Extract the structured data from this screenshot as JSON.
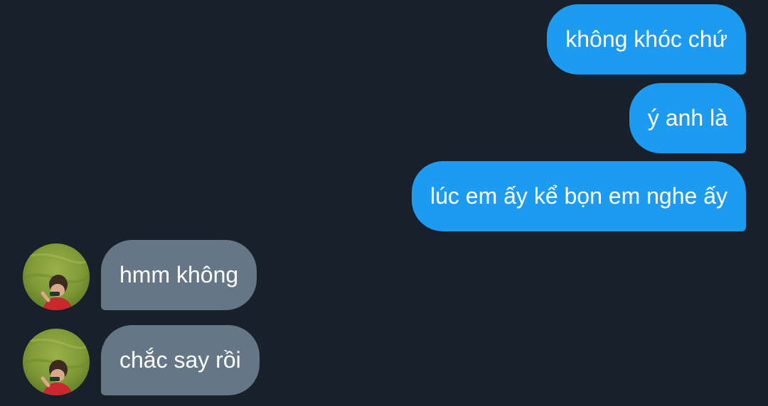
{
  "conversation": {
    "messages": [
      {
        "sender": "me",
        "text": "không khóc chứ"
      },
      {
        "sender": "me",
        "text": "ý anh là"
      },
      {
        "sender": "me",
        "text": "lúc em ấy kể bọn em nghe ấy"
      },
      {
        "sender": "other",
        "text": "hmm không"
      },
      {
        "sender": "other",
        "text": "chắc say rồi"
      }
    ]
  },
  "colors": {
    "background": "#18202b",
    "sent_bubble": "#1d9bf0",
    "received_bubble": "#657786",
    "text": "#ffffff"
  },
  "icons": {
    "avatar": "user-avatar-photo"
  }
}
